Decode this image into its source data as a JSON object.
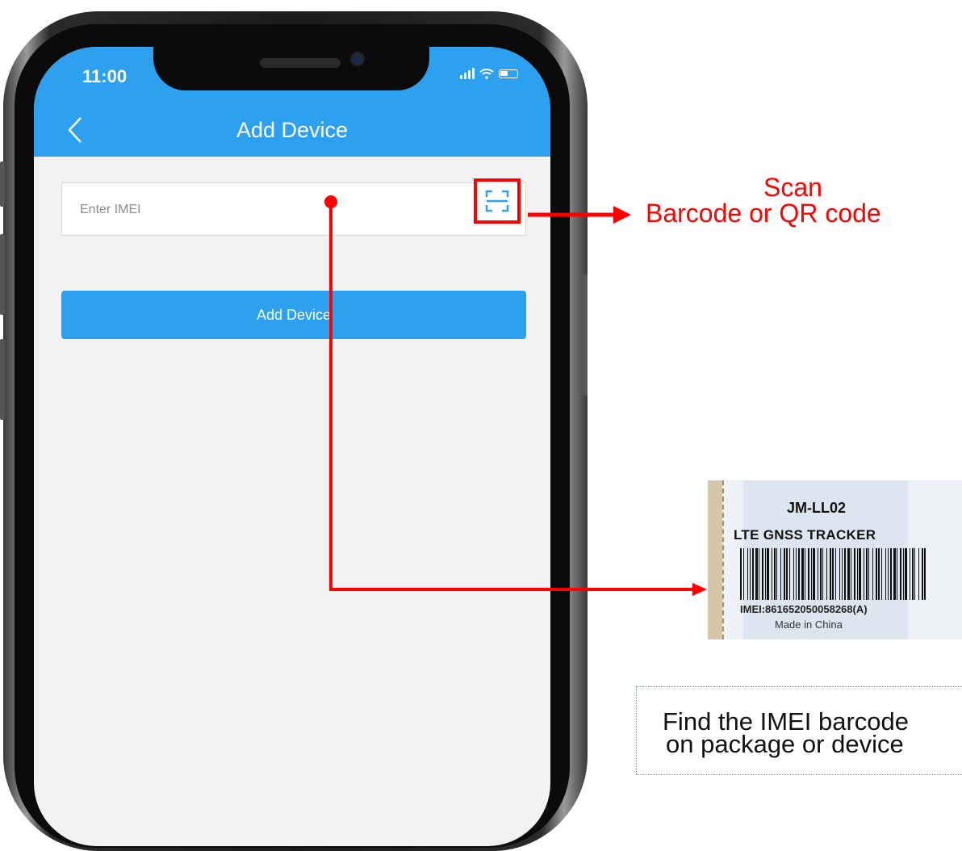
{
  "status_bar": {
    "time": "11:00"
  },
  "header": {
    "title": "Add Device"
  },
  "imei_field": {
    "value": "",
    "placeholder": "Enter IMEI"
  },
  "add_button": {
    "label": "Add Device"
  },
  "annotations": {
    "scan_label_line1": "Scan",
    "scan_label_line2": "Barcode or QR code",
    "highlight_color": "#ff0000",
    "find_note_line1": "Find the IMEI barcode",
    "find_note_line2": "on package or device"
  },
  "device_label": {
    "model": "JM-LL02",
    "product": "LTE GNSS TRACKER",
    "imei": "IMEI:861652050058268(A)",
    "origin": "Made in China"
  },
  "colors": {
    "app_blue": "#2ea0f0",
    "screen_bg": "#f2f2f2"
  },
  "icons": [
    "back-chevron-icon",
    "scan-icon",
    "signal-icon",
    "wifi-icon",
    "battery-icon"
  ]
}
